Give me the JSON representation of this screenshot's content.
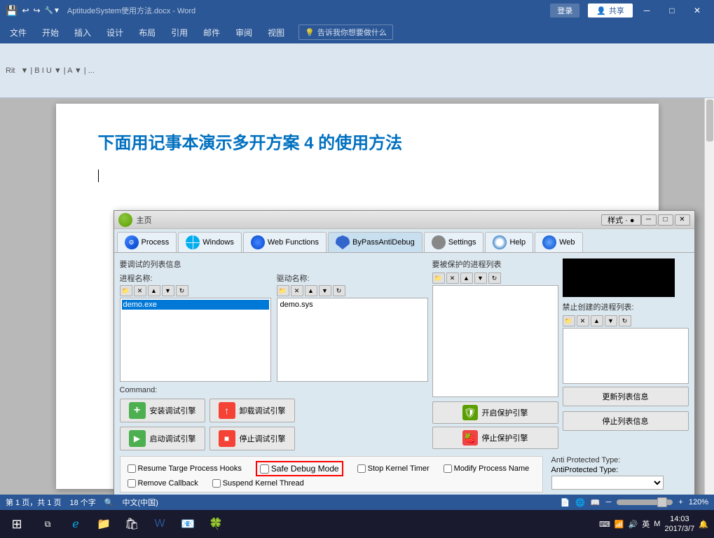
{
  "window": {
    "title": "AptitudeSystem使用方法.docx - Word",
    "login": "登录",
    "share": "共享"
  },
  "ribbon": {
    "tabs": [
      "文件",
      "开始",
      "插入",
      "设计",
      "布局",
      "引用",
      "邮件",
      "审阅",
      "视图"
    ],
    "tell_me": "告诉我你想要做什么"
  },
  "document": {
    "heading": "下面用记事本演示多开方案 4 的使用方法"
  },
  "app_window": {
    "title_icon": "",
    "title": "主页",
    "style_btn": "样式 · ●",
    "tabs": [
      {
        "label": "Process"
      },
      {
        "label": "Windows"
      },
      {
        "label": "Web Functions"
      },
      {
        "label": "ByPassAntiDebug"
      },
      {
        "label": "Settings"
      },
      {
        "label": "Help"
      },
      {
        "label": "Web"
      }
    ],
    "section_process": {
      "title": "要调试的列表信息",
      "process_name_label": "进程名称:",
      "driver_name_label": "驱动名称:",
      "process_list": [
        "demo.exe"
      ],
      "driver_list": [
        "demo.sys"
      ]
    },
    "section_protected": {
      "title": "要被保护的进程列表"
    },
    "forbidden_section": {
      "title": "禁止创建的进程列表:"
    },
    "command_label": "Command:",
    "buttons": [
      {
        "label": "安装调试引擎",
        "icon_type": "green-plus"
      },
      {
        "label": "卸载调试引擎",
        "icon_type": "red-up"
      },
      {
        "label": "启动调试引擎",
        "icon_type": "green-play"
      },
      {
        "label": "停止调试引擎",
        "icon_type": "red-stop"
      }
    ],
    "protected_buttons": [
      {
        "label": "开启保护引擎"
      },
      {
        "label": "停止保护引擎"
      }
    ],
    "right_buttons": [
      {
        "label": "更新列表信息"
      },
      {
        "label": "停止列表信息"
      }
    ],
    "checkboxes": [
      {
        "label": "Resume Targe Process Hooks",
        "checked": false
      },
      {
        "label": "Safe Debug Mode",
        "checked": false,
        "highlight": true
      },
      {
        "label": "Stop Kernel Timer",
        "checked": false
      },
      {
        "label": "Modify Process Name",
        "checked": false
      },
      {
        "label": "Remove Callback",
        "checked": false
      },
      {
        "label": "Suspend Kernel Thread",
        "checked": false
      }
    ],
    "anti_protected": {
      "label": "Anti Protected Type:",
      "sub_label": "AntiProtected Type:"
    }
  },
  "statusbar": {
    "page": "第 1 页，共 1 页",
    "chars": "18 个字",
    "lang": "中文(中国)",
    "zoom": "120%"
  },
  "taskbar": {
    "time": "14:03",
    "date": "2017/3/7",
    "lang": "英",
    "ime": "M"
  }
}
